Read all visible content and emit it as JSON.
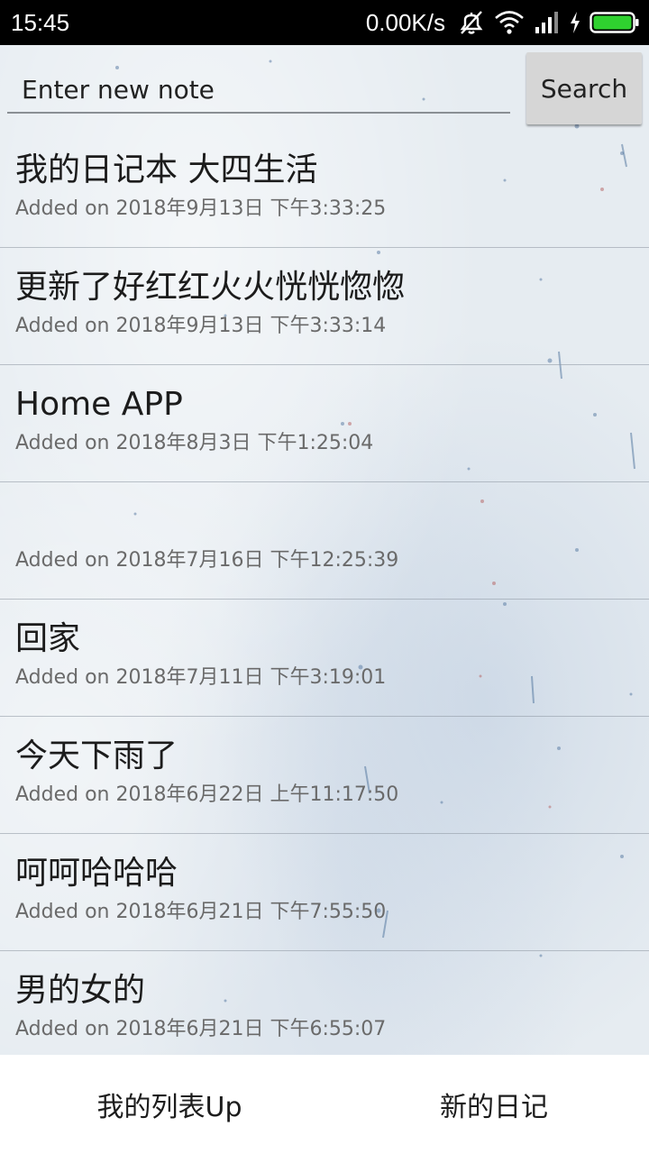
{
  "status_bar": {
    "time": "15:45",
    "network_speed": "0.00K/s",
    "icons": [
      "mute-icon",
      "wifi-icon",
      "signal-icon",
      "charging-icon",
      "battery-icon"
    ],
    "battery_color": "#2fd12f"
  },
  "search": {
    "placeholder": "Enter new note",
    "button_label": "Search"
  },
  "notes": [
    {
      "title": "我的日记本 大四生活",
      "date": "Added on 2018年9月13日 下午3:33:25"
    },
    {
      "title": "更新了好红红火火恍恍惚惚",
      "date": "Added on 2018年9月13日 下午3:33:14"
    },
    {
      "title": "Home APP",
      "date": "Added on 2018年8月3日 下午1:25:04"
    },
    {
      "title": "",
      "date": "Added on 2018年7月16日 下午12:25:39"
    },
    {
      "title": "回家",
      "date": "Added on 2018年7月11日 下午3:19:01"
    },
    {
      "title": "今天下雨了",
      "date": "Added on 2018年6月22日 上午11:17:50"
    },
    {
      "title": "呵呵哈哈哈",
      "date": "Added on 2018年6月21日 下午7:55:50"
    },
    {
      "title": "男的女的",
      "date": "Added on 2018年6月21日 下午6:55:07"
    }
  ],
  "bottom_bar": {
    "left_label": "我的列表Up",
    "right_label": "新的日记"
  }
}
